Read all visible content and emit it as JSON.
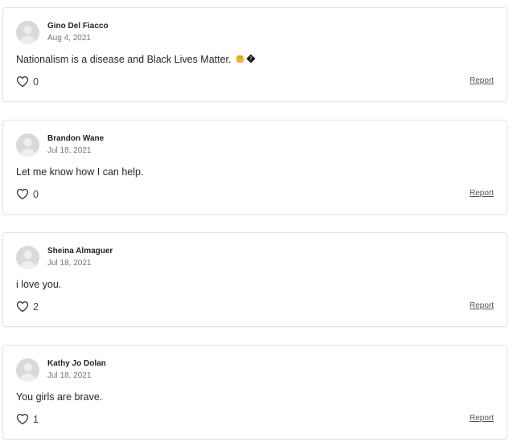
{
  "comments": [
    {
      "author": "Gino Del Fiacco",
      "date": "Aug 4, 2021",
      "text": "Nationalism is a disease and Black Lives Matter.",
      "emoji_tail": "✊�",
      "likes": "0",
      "report_label": "Report"
    },
    {
      "author": "Brandon Wane",
      "date": "Jul 18, 2021",
      "text": "Let me know how I can help.",
      "likes": "0",
      "report_label": "Report"
    },
    {
      "author": "Sheina Almaguer",
      "date": "Jul 18, 2021",
      "text": "i love you.",
      "likes": "2",
      "report_label": "Report"
    },
    {
      "author": "Kathy Jo Dolan",
      "date": "Jul 18, 2021",
      "text": "You girls are brave.",
      "likes": "1",
      "report_label": "Report"
    }
  ],
  "icons": {
    "avatar": "default-user-avatar-icon",
    "like": "heart-outline-icon"
  },
  "colors": {
    "card_border": "#e3e3e3",
    "avatar_bg": "#d9d9d9",
    "avatar_fg": "#ffffff",
    "text": "#262626",
    "muted": "#767676"
  }
}
